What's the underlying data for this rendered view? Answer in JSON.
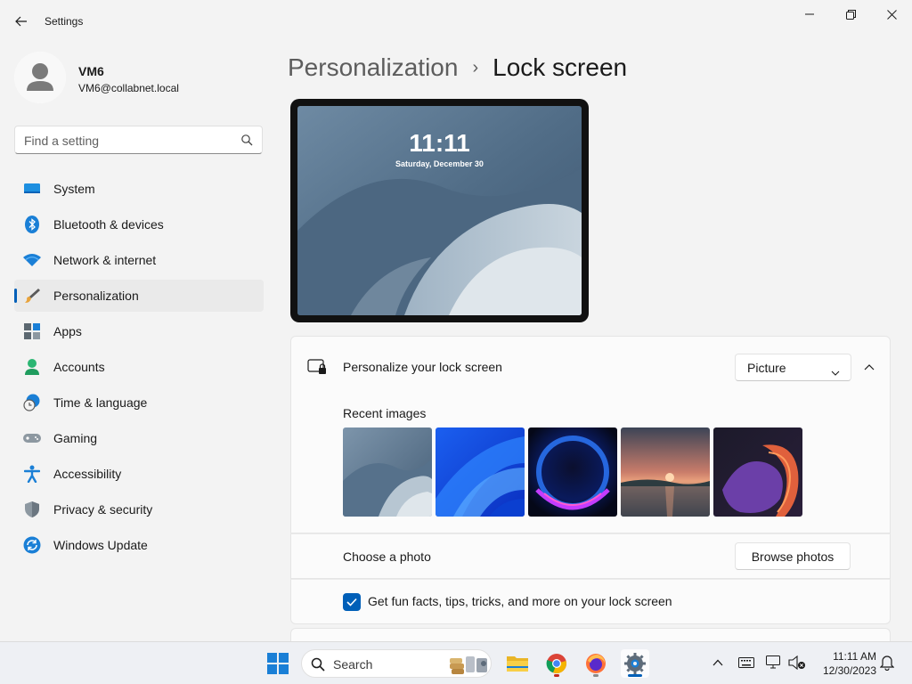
{
  "window": {
    "title": "Settings",
    "minimize_glyph": "—",
    "maximize_glyph": "⧉",
    "close_glyph": "✕"
  },
  "profile": {
    "name": "VM6",
    "email": "VM6@collabnet.local"
  },
  "search": {
    "placeholder": "Find a setting"
  },
  "sidebar": {
    "items": [
      {
        "label": "System",
        "icon": "system-icon"
      },
      {
        "label": "Bluetooth & devices",
        "icon": "bluetooth-icon"
      },
      {
        "label": "Network & internet",
        "icon": "wifi-icon"
      },
      {
        "label": "Personalization",
        "icon": "brush-icon",
        "active": true
      },
      {
        "label": "Apps",
        "icon": "apps-icon"
      },
      {
        "label": "Accounts",
        "icon": "accounts-icon"
      },
      {
        "label": "Time & language",
        "icon": "time-language-icon"
      },
      {
        "label": "Gaming",
        "icon": "gaming-icon"
      },
      {
        "label": "Accessibility",
        "icon": "accessibility-icon"
      },
      {
        "label": "Privacy & security",
        "icon": "shield-icon"
      },
      {
        "label": "Windows Update",
        "icon": "update-icon"
      }
    ]
  },
  "breadcrumb": {
    "parent": "Personalization",
    "separator": "›",
    "current": "Lock screen"
  },
  "preview": {
    "time": "11:11",
    "date": "Saturday, December 30"
  },
  "lock_screen": {
    "personalize_label": "Personalize your lock screen",
    "personalize_value": "Picture",
    "recent_images_label": "Recent images",
    "recent_images": [
      "bloom-gray",
      "bloom-blue",
      "glow-dark",
      "sunset-lake",
      "ribbon-purple"
    ],
    "choose_photo_label": "Choose a photo",
    "browse_button": "Browse photos",
    "fun_facts_label": "Get fun facts, tips, tricks, and more on your lock screen",
    "fun_facts_checked": true
  },
  "taskbar": {
    "search_label": "Search",
    "time": "11:11 AM",
    "date": "12/30/2023"
  },
  "colors": {
    "accent": "#005fb8",
    "background": "#f3f3f3",
    "card": "#fbfbfb"
  }
}
